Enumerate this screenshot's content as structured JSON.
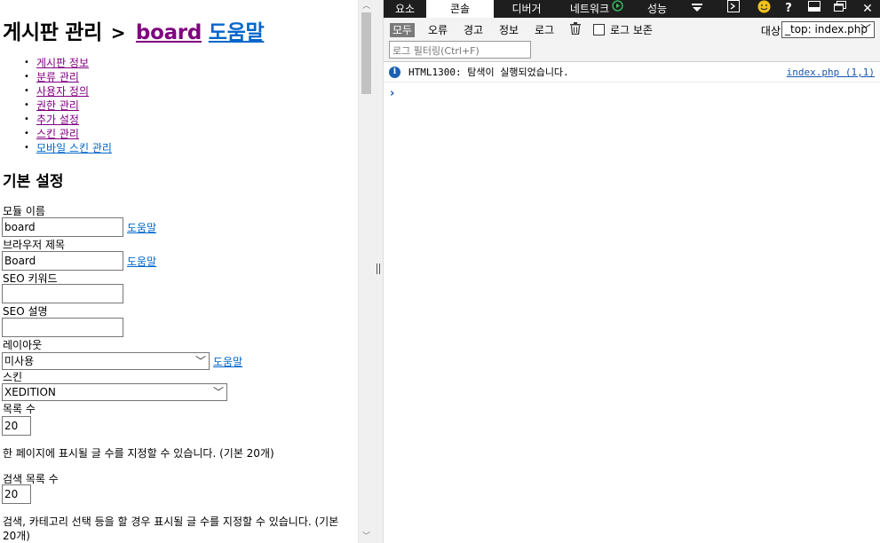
{
  "page": {
    "title_main": "게시판 관리",
    "title_sep": ">",
    "title_module": "board",
    "title_help": "도움말",
    "nav": [
      "게시판 정보",
      "분류 관리",
      "사용자 정의",
      "권한 관리",
      "추가 설정",
      "스킨 관리",
      "모바일 스킨 관리"
    ],
    "section_title": "기본 설정",
    "fields": {
      "module_name_label": "모듈 이름",
      "module_name_value": "board",
      "help": "도움말",
      "browser_title_label": "브라우저 제목",
      "browser_title_value": "Board",
      "seo_keywords_label": "SEO 키워드",
      "seo_desc_label": "SEO 설명",
      "layout_label": "레이아웃",
      "layout_value": "미사용",
      "skin_label": "스킨",
      "skin_value": "XEDITION",
      "list_count_label": "목록 수",
      "list_count_value": "20",
      "list_count_desc": "한 페이지에 표시될 글 수를 지정할 수 있습니다. (기본 20개)",
      "search_list_count_label": "검색 목록 수",
      "search_list_count_value": "20",
      "search_list_count_desc": "검색, 카테고리 선택 등을 할 경우 표시될 글 수를 지정할 수 있습니다. (기본 20개)"
    }
  },
  "devtools": {
    "tabs": [
      "요소",
      "콘솔",
      "디버거",
      "네트워크",
      "성능"
    ],
    "active_tab": "콘솔",
    "filters": [
      "모두",
      "오류",
      "경고",
      "정보",
      "로그"
    ],
    "active_filter": "모두",
    "preserve_log_label": "로그 보존",
    "log_filter_placeholder": "로그 필터링(Ctrl+F)",
    "target_label": "대상",
    "target_value": "_top: index.php",
    "messages": [
      {
        "code": "HTML1300:",
        "text": "탐색이 실행되었습니다.",
        "source": "index.php (1,1)"
      }
    ],
    "prompt_symbol": "›"
  }
}
